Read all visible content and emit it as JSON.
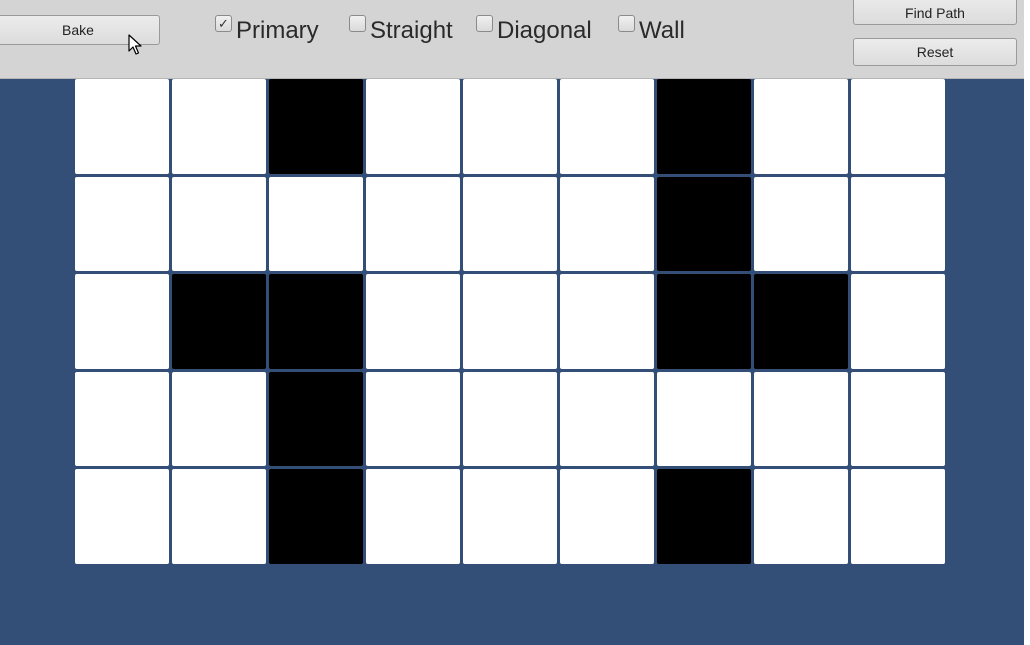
{
  "toolbar": {
    "bake_label": "Bake",
    "find_path_label": "Find Path",
    "reset_label": "Reset",
    "toggles": [
      {
        "label": "Primary",
        "checked": true
      },
      {
        "label": "Straight",
        "checked": false
      },
      {
        "label": "Diagonal",
        "checked": false
      },
      {
        "label": "Wall",
        "checked": false
      }
    ]
  },
  "grid": {
    "columns": 9,
    "rows": 5,
    "cells": [
      [
        0,
        0,
        1,
        0,
        0,
        0,
        1,
        0,
        0
      ],
      [
        0,
        0,
        0,
        0,
        0,
        0,
        1,
        0,
        0
      ],
      [
        0,
        1,
        1,
        0,
        0,
        0,
        1,
        1,
        0
      ],
      [
        0,
        0,
        1,
        0,
        0,
        0,
        0,
        0,
        0
      ],
      [
        0,
        0,
        1,
        0,
        0,
        0,
        1,
        0,
        0
      ]
    ]
  },
  "colors": {
    "background": "#334f78",
    "toolbar": "#d4d4d4",
    "open_cell": "#ffffff",
    "wall_cell": "#000000"
  },
  "icons": {
    "cursor": "arrow-cursor-icon",
    "checkmark": "checkmark-icon"
  }
}
